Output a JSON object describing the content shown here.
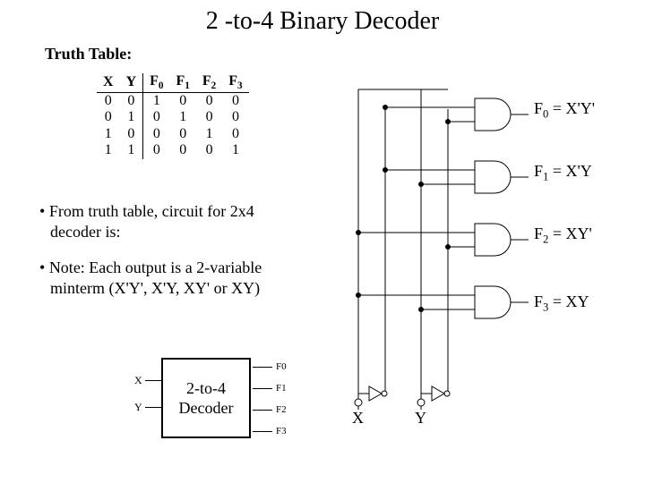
{
  "title": "2 -to-4 Binary Decoder",
  "subtitle": "Truth Table:",
  "truth_table": {
    "headers": [
      "X",
      "Y",
      "F0",
      "F1",
      "F2",
      "F3"
    ],
    "rows": [
      [
        "0",
        "0",
        "1",
        "0",
        "0",
        "0"
      ],
      [
        "0",
        "1",
        "0",
        "1",
        "0",
        "0"
      ],
      [
        "1",
        "0",
        "0",
        "0",
        "1",
        "0"
      ],
      [
        "1",
        "1",
        "0",
        "0",
        "0",
        "1"
      ]
    ]
  },
  "bullets": {
    "b1": "From truth table, circuit for 2x4 decoder is:",
    "b2": "Note: Each output is a 2-variable minterm (X'Y', X'Y, XY' or XY)"
  },
  "block": {
    "in": [
      "X",
      "Y"
    ],
    "label1": "2-to-4",
    "label2": "Decoder",
    "out": [
      "F0",
      "F1",
      "F2",
      "F3"
    ]
  },
  "gates": {
    "g0a": "F",
    "g0b": "0",
    "g0c": " = X'Y'",
    "g1a": "F",
    "g1b": "1",
    "g1c": " = X'Y",
    "g2a": "F",
    "g2b": "2",
    "g2c": " = XY'",
    "g3a": "F",
    "g3b": "3",
    "g3c": " = XY"
  },
  "inputs": {
    "x": "X",
    "y": "Y"
  }
}
